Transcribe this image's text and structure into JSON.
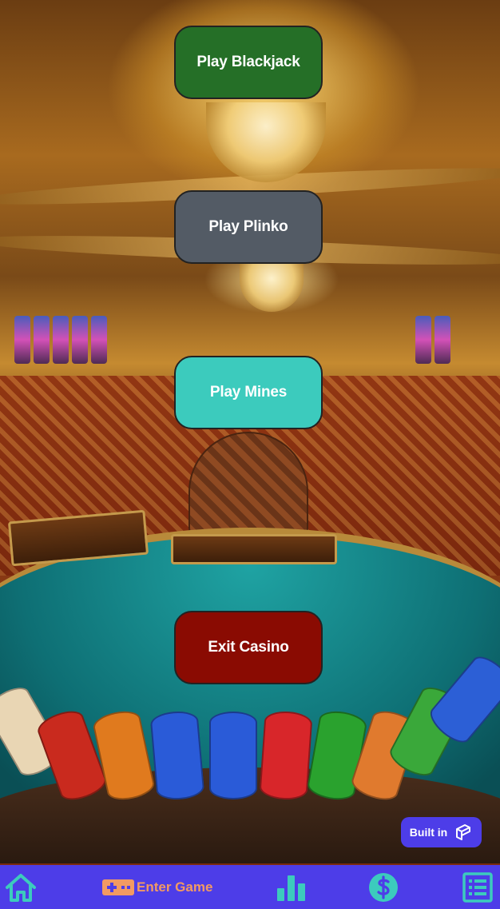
{
  "menu": {
    "blackjack_label": "Play Blackjack",
    "plinko_label": "Play Plinko",
    "mines_label": "Play Mines",
    "exit_label": "Exit Casino"
  },
  "badge": {
    "built_in_label": "Built in"
  },
  "nav": {
    "home_icon": "home-icon",
    "enter_game_label": "Enter Game",
    "enter_game_icon": "gamepad-icon",
    "stats_icon": "bar-chart-icon",
    "currency_icon": "dollar-icon",
    "list_icon": "list-icon"
  },
  "colors": {
    "blackjack": "#256f27",
    "plinko": "#535b65",
    "mines": "#3ccbbd",
    "exit": "#8a0b02",
    "nav_bg": "#4d3de8",
    "nav_icon": "#3ccbbd",
    "nav_accent": "#f29a63"
  }
}
